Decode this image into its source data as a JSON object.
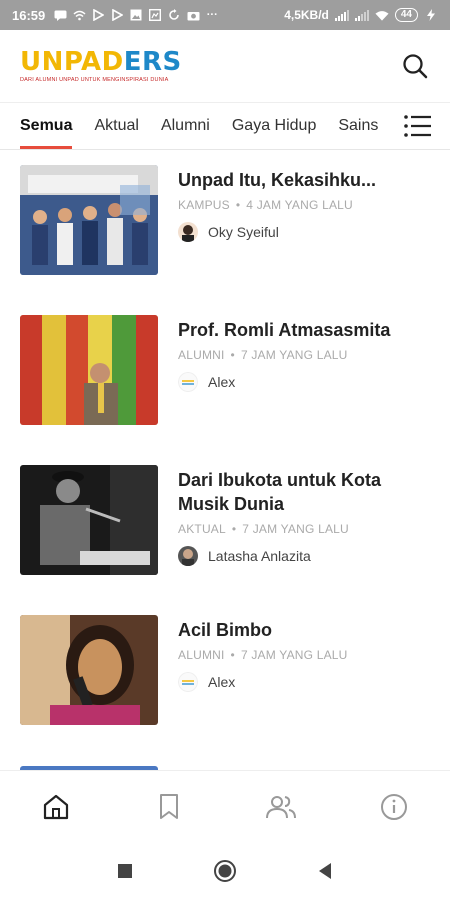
{
  "status_bar": {
    "time": "16:59",
    "net_speed": "4,5KB/d",
    "battery": "44",
    "icons": [
      "chat-icon",
      "wifi-icon",
      "play-icon",
      "play-icon",
      "gallery-icon",
      "cast-icon",
      "sync-icon",
      "camera-icon",
      "more-icon",
      "signal-icon",
      "signal-icon",
      "wifi-icon",
      "charging-icon"
    ]
  },
  "header": {
    "logo_part1": "UNPAD",
    "logo_part2": "ERS",
    "tagline": "DARI ALUMNI UNPAD UNTUK MENGINSPIRASI DUNIA",
    "search_icon": "search-icon"
  },
  "tabs": {
    "items": [
      "Semua",
      "Aktual",
      "Alumni",
      "Gaya Hidup",
      "Sains"
    ],
    "active": 0,
    "menu_icon": "menu-list-icon"
  },
  "articles": [
    {
      "title": "Unpad Itu,  Kekasihku...",
      "category": "KAMPUS",
      "time": "4 JAM YANG LALU",
      "author": "Oky Syeiful"
    },
    {
      "title": "Prof. Romli Atmasasmita",
      "category": "ALUMNI",
      "time": "7 JAM YANG LALU",
      "author": "Alex"
    },
    {
      "title": "Dari Ibukota untuk Kota Musik Dunia",
      "category": "AKTUAL",
      "time": "7 JAM YANG LALU",
      "author": "Latasha Anlazita"
    },
    {
      "title": "Acil Bimbo",
      "category": "ALUMNI",
      "time": "7 JAM YANG LALU",
      "author": "Alex"
    }
  ],
  "bottom_nav": [
    "home-icon",
    "bookmark-icon",
    "users-icon",
    "info-icon"
  ],
  "system_nav": [
    "recents-icon",
    "home-circle-icon",
    "back-icon"
  ],
  "colors": {
    "accent": "#e74c3c",
    "logo_yellow": "#f2b705",
    "logo_blue": "#1e88c8",
    "status_bar": "#9e9e9e"
  }
}
